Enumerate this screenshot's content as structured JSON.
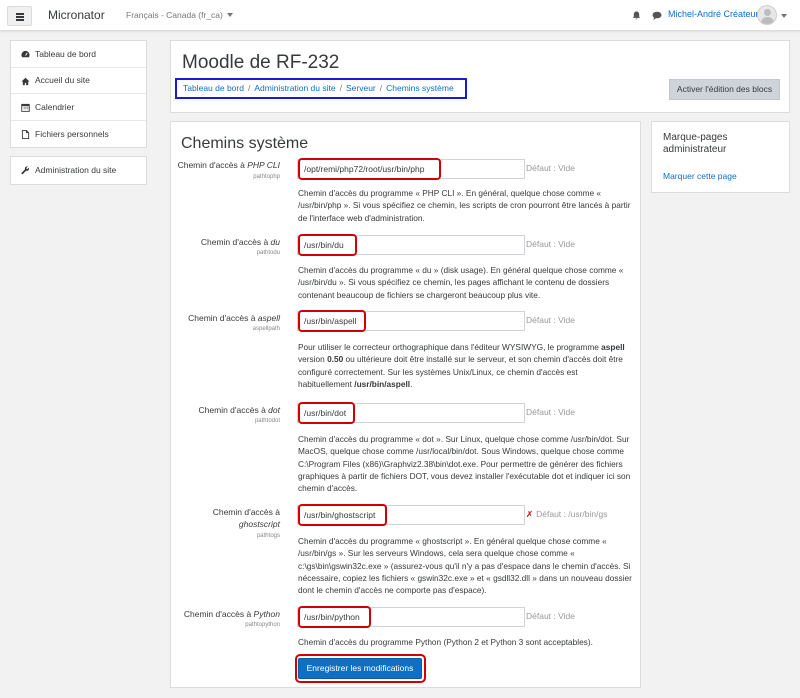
{
  "navbar": {
    "site_name": "Micronator",
    "language": "Français - Canada (fr_ca)",
    "user_name": "Michel-André Créateur"
  },
  "drawer": {
    "items": [
      {
        "label": "Tableau de bord",
        "icon": "dashboard-icon"
      },
      {
        "label": "Accueil du site",
        "icon": "home-icon"
      },
      {
        "label": "Calendrier",
        "icon": "calendar-icon"
      },
      {
        "label": "Fichiers personnels",
        "icon": "file-icon"
      }
    ],
    "admin_item": {
      "label": "Administration du site",
      "icon": "wrench-icon"
    }
  },
  "header": {
    "title": "Moodle de RF-232",
    "breadcrumb": [
      "Tableau de bord",
      "Administration du site",
      "Serveur",
      "Chemins système"
    ],
    "edit_button": "Activer l'édition des blocs"
  },
  "settings": {
    "section_title": "Chemins système",
    "items": [
      {
        "label_prefix": "Chemin d'accès à ",
        "label_em": "PHP CLI",
        "key": "pathtophp",
        "value": "/opt/remi/php72/root/usr/bin/php",
        "default": "Défaut : Vide",
        "description": "Chemin d'accès du programme « PHP CLI ». En général, quelque chose comme « /usr/bin/php ». Si vous spécifiez ce chemin, les scripts de cron pourront être lancés à partir de l'interface web d'administration."
      },
      {
        "label_prefix": "Chemin d'accès à ",
        "label_em": "du",
        "key": "pathtodu",
        "value": "/usr/bin/du",
        "default": "Défaut : Vide",
        "description": "Chemin d'accès du programme « du » (disk usage). En général quelque chose comme « /usr/bin/du ». Si vous spécifiez ce chemin, les pages affichant le contenu de dossiers contenant beaucoup de fichiers se chargeront beaucoup plus vite."
      },
      {
        "label_prefix": "Chemin d'accès à ",
        "label_em": "aspell",
        "key": "aspellpath",
        "value": "/usr/bin/aspell",
        "default": "Défaut : Vide",
        "description_parts": [
          "Pour utiliser le correcteur orthographique dans l'éditeur WYSIWYG, le programme ",
          "aspell",
          " version ",
          "0.50",
          " ou ultérieure doit être installé sur le serveur, et son chemin d'accès doit être configuré correctement. Sur les systèmes Unix/Linux, ce chemin d'accès est habituellement ",
          "/usr/bin/aspell",
          "."
        ]
      },
      {
        "label_prefix": "Chemin d'accès à ",
        "label_em": "dot",
        "key": "pathtodot",
        "value": "/usr/bin/dot",
        "default": "Défaut : Vide",
        "description": "Chemin d'accès du programme « dot ». Sur Linux, quelque chose comme /usr/bin/dot. Sur MacOS, quelque chose comme /usr/local/bin/dot. Sous Windows, quelque chose comme C:\\Program Files (x86)\\Graphviz2.38\\bin\\dot.exe. Pour permettre de générer des fichiers graphiques à partir de fichiers DOT, vous devez installer l'exécutable dot et indiquer ici son chemin d'accès."
      },
      {
        "label_prefix": "Chemin d'accès à ",
        "label_em": "ghostscript",
        "key": "pathtogs",
        "value": "/usr/bin/ghostscript",
        "default_warning": "✗",
        "default": "Défaut : /usr/bin/gs",
        "description": "Chemin d'accès du programme « ghostscript ». En général quelque chose comme « /usr/bin/gs ». Sur les serveurs Windows, cela sera quelque chose comme « c:\\gs\\bin\\gswin32c.exe » (assurez-vous qu'il n'y a pas d'espace dans le chemin d'accès. Si nécessaire, copiez les fichiers « gswin32c.exe » et « gsdll32.dll » dans un nouveau dossier dont le chemin d'accès ne comporte pas d'espace)."
      },
      {
        "label_prefix": "Chemin d'accès à ",
        "label_em": "Python",
        "key": "pathtopython",
        "value": "/usr/bin/python",
        "default": "Défaut : Vide",
        "description": "Chemin d'accès du programme Python (Python 2 et Python 3 sont acceptables)."
      }
    ],
    "save_button": "Enregistrer les modifications"
  },
  "side_block": {
    "title": "Marque-pages administrateur",
    "link": "Marquer cette page"
  },
  "colors": {
    "link": "#0f6fc5",
    "highlight_red": "#d20000",
    "highlight_blue": "#1b1bd6",
    "primary_button": "#0f6fc5"
  }
}
